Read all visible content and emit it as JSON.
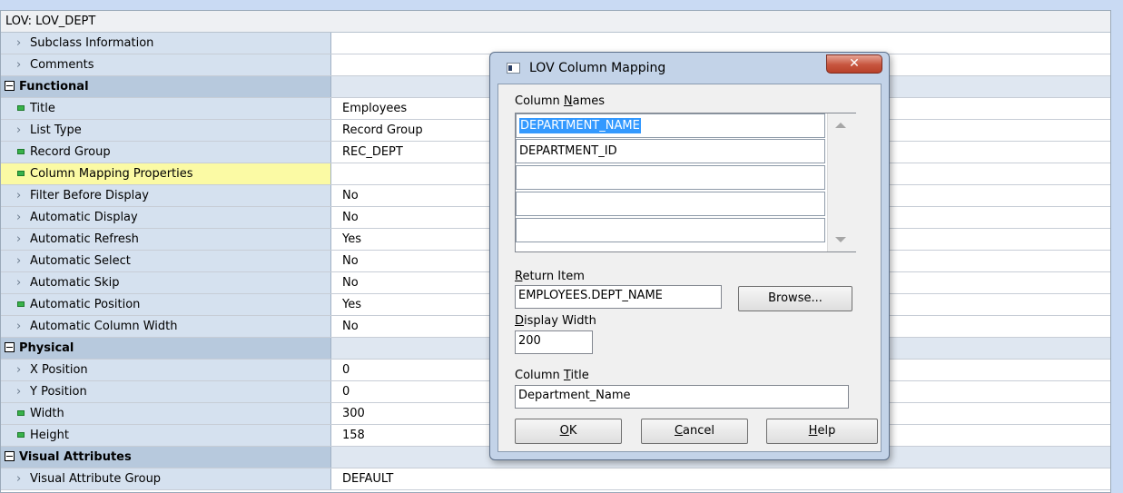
{
  "palette": {
    "title": "LOV: LOV_DEPT",
    "rows": [
      {
        "kind": "prop",
        "marker": "plain",
        "name": "Subclass Information",
        "value": ""
      },
      {
        "kind": "prop",
        "marker": "plain",
        "name": "Comments",
        "value": ""
      },
      {
        "kind": "cat",
        "name": "Functional",
        "value": ""
      },
      {
        "kind": "prop",
        "marker": "changed",
        "name": "Title",
        "value": "Employees"
      },
      {
        "kind": "prop",
        "marker": "plain",
        "name": "List Type",
        "value": "Record Group"
      },
      {
        "kind": "prop",
        "marker": "changed",
        "name": "Record Group",
        "value": "REC_DEPT"
      },
      {
        "kind": "sel",
        "marker": "changed",
        "name": "Column Mapping Properties",
        "value": ""
      },
      {
        "kind": "prop",
        "marker": "plain",
        "name": "Filter Before Display",
        "value": "No"
      },
      {
        "kind": "prop",
        "marker": "plain",
        "name": "Automatic Display",
        "value": "No"
      },
      {
        "kind": "prop",
        "marker": "plain",
        "name": "Automatic Refresh",
        "value": "Yes"
      },
      {
        "kind": "prop",
        "marker": "plain",
        "name": "Automatic Select",
        "value": "No"
      },
      {
        "kind": "prop",
        "marker": "plain",
        "name": "Automatic Skip",
        "value": "No"
      },
      {
        "kind": "prop",
        "marker": "changed",
        "name": "Automatic Position",
        "value": "Yes"
      },
      {
        "kind": "prop",
        "marker": "plain",
        "name": "Automatic Column Width",
        "value": "No"
      },
      {
        "kind": "cat",
        "name": "Physical",
        "value": ""
      },
      {
        "kind": "prop",
        "marker": "plain",
        "name": "X Position",
        "value": "0"
      },
      {
        "kind": "prop",
        "marker": "plain",
        "name": "Y Position",
        "value": "0"
      },
      {
        "kind": "prop",
        "marker": "changed",
        "name": "Width",
        "value": "300"
      },
      {
        "kind": "prop",
        "marker": "changed",
        "name": "Height",
        "value": "158"
      },
      {
        "kind": "cat",
        "name": "Visual Attributes",
        "value": ""
      },
      {
        "kind": "prop",
        "marker": "plain",
        "name": "Visual Attribute Group",
        "value": "DEFAULT"
      }
    ]
  },
  "dialog": {
    "title": "LOV Column Mapping",
    "close_glyph": "✕",
    "column_names_label_pre": "Column ",
    "column_names_label_key": "N",
    "column_names_label_post": "ames",
    "columns": [
      "DEPARTMENT_NAME",
      "DEPARTMENT_ID",
      "",
      "",
      ""
    ],
    "return_item_label_key": "R",
    "return_item_label_post": "eturn Item",
    "return_item_value": "EMPLOYEES.DEPT_NAME",
    "browse_label": "Browse...",
    "display_width_label_key": "D",
    "display_width_label_post": "isplay Width",
    "display_width_value": "200",
    "column_title_label_pre": "Column ",
    "column_title_label_key": "T",
    "column_title_label_post": "itle",
    "column_title_value": "Department_Name",
    "ok_key": "O",
    "ok_post": "K",
    "cancel_key": "C",
    "cancel_post": "ancel",
    "help_key": "H",
    "help_post": "elp"
  }
}
